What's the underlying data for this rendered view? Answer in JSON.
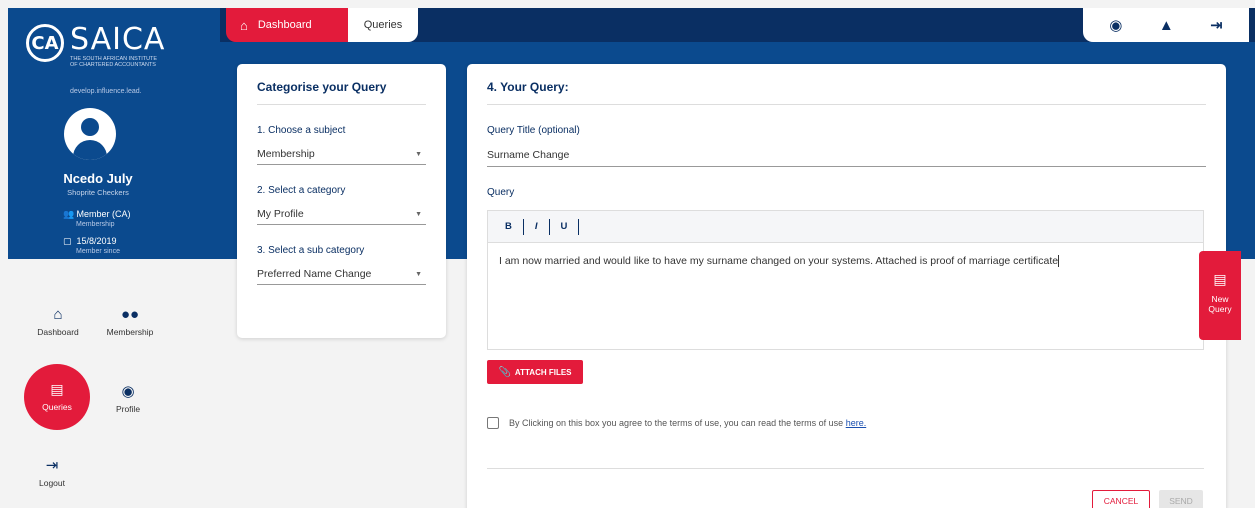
{
  "brand": {
    "logo_mark": "CA",
    "name": "SAICA",
    "subtitle_line1": "THE SOUTH AFRICAN INSTITUTE",
    "subtitle_line2": "OF CHARTERED ACCOUNTANTS",
    "tagline": "develop.influence.lead.",
    "accent": "#e31b3b",
    "primary": "#0b4a8e",
    "dark": "#0a2f63"
  },
  "user": {
    "name": "Ncedo July",
    "company": "Shoprite Checkers",
    "member_type": "Member (CA)",
    "member_type_sub": "Membership",
    "member_since_date": "15/8/2019",
    "member_since_label": "Member since"
  },
  "nav": {
    "dashboard": "Dashboard",
    "membership": "Membership",
    "queries": "Queries",
    "profile": "Profile",
    "logout": "Logout"
  },
  "top_tabs": {
    "dashboard": "Dashboard",
    "queries": "Queries"
  },
  "categorise": {
    "title": "Categorise your Query",
    "subject_label": "1. Choose a subject",
    "subject_value": "Membership",
    "category_label": "2. Select a category",
    "category_value": "My Profile",
    "subcategory_label": "3. Select a sub category",
    "subcategory_value": "Preferred Name Change"
  },
  "query": {
    "title": "4. Your Query:",
    "title_label": "Query Title (optional)",
    "title_value": "Surname Change",
    "query_label": "Query",
    "toolbar": {
      "bold": "B",
      "italic": "I",
      "underline": "U"
    },
    "body": "I am now married and would like to have my surname changed on your systems. Attached is proof of  marriage certificate",
    "attach_label": "ATTACH FILES",
    "terms_text": "By Clicking on this box you agree to the terms of use, you can read the terms of use",
    "terms_link": "here.",
    "cancel_label": "CANCEL",
    "send_label": "SEND"
  },
  "new_query": {
    "line1": "New",
    "line2": "Query"
  }
}
